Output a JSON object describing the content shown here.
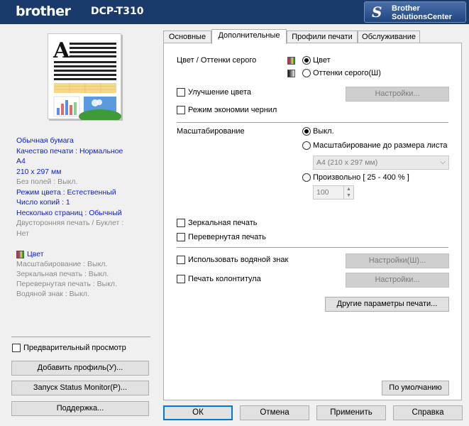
{
  "header": {
    "brand": "brother",
    "model": "DCP-T310",
    "solutions_center_line1": "Brother",
    "solutions_center_line2": "SolutionsCenter"
  },
  "summary": {
    "paper_type": "Обычная бумага",
    "quality": "Качество печати : Нормальное",
    "paper_size": "A4",
    "dimensions": "210 x 297 мм",
    "borderless": "Без полей : Выкл.",
    "color_mode": "Режим цвета : Естественный",
    "copies": "Число копий : 1",
    "multi_page": "Несколько страниц : Обычный",
    "duplex": "Двусторонняя печать / Буклет :",
    "duplex_value": "Нет",
    "color": "Цвет",
    "scaling": "Масштабирование : Выкл.",
    "mirror": "Зеркальная печать : Выкл.",
    "reverse": "Перевернутая печать : Выкл.",
    "watermark": "Водяной знак : Выкл."
  },
  "left_controls": {
    "preview_label": "Предварительный просмотр",
    "add_profile": "Добавить профиль(У)...",
    "status_monitor": "Запуск Status Monitor(P)...",
    "support": "Поддержка..."
  },
  "tabs": [
    "Основные",
    "Дополнительные",
    "Профили печати",
    "Обслуживание"
  ],
  "advanced": {
    "color_grayscale_label": "Цвет / Оттенки серого",
    "color_option": "Цвет",
    "grayscale_option": "Оттенки серого(Ш)",
    "color_enhancement": "Улучшение цвета",
    "settings_button": "Настройки...",
    "ink_save": "Режим экономии чернил",
    "scaling_label": "Масштабирование",
    "scaling_off": "Выкл.",
    "fit_to_paper": "Масштабирование до размера листа",
    "paper_select": "A4 (210 x 297 мм)",
    "custom": "Произвольно [ 25 - 400 % ]",
    "custom_value": "100",
    "mirror": "Зеркальная печать",
    "reverse": "Перевернутая печать",
    "use_watermark": "Использовать водяной знак",
    "watermark_settings": "Настройки(Ш)...",
    "header_footer": "Печать колонтитула",
    "header_footer_settings": "Настройки...",
    "other_options": "Другие параметры печати...",
    "default": "По умолчанию"
  },
  "footer": {
    "ok": "ОК",
    "cancel": "Отмена",
    "apply": "Применить",
    "help": "Справка"
  },
  "colors": {
    "header_bg": "#1a3a6b",
    "summary_text": "#0f1fbd",
    "disabled_text": "#8a8a8a"
  }
}
